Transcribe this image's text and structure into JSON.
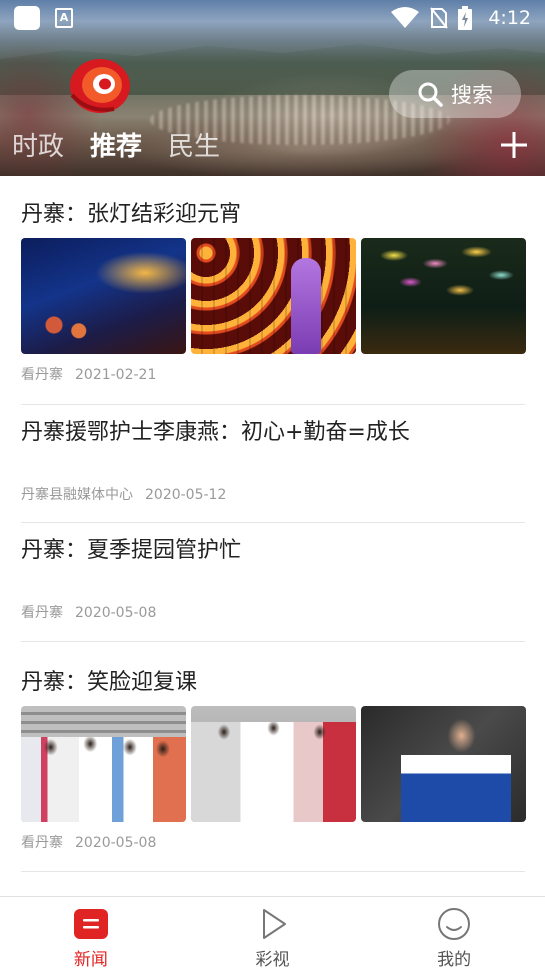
{
  "status_bar": {
    "time": "4:12",
    "icons": [
      "notification-square-icon",
      "app-a-icon",
      "wifi-icon",
      "no-sim-icon",
      "battery-charging-icon"
    ]
  },
  "header": {
    "search_label": "搜索",
    "tabs": [
      {
        "label": "时政",
        "active": false
      },
      {
        "label": "推荐",
        "active": true
      },
      {
        "label": "民生",
        "active": false
      }
    ],
    "add_icon": "plus-icon",
    "accent_color": "#e02424"
  },
  "articles": [
    {
      "title": "丹寨：张灯结彩迎元宵",
      "source": "看丹寨",
      "date": "2021-02-21",
      "has_images": true
    },
    {
      "title": "丹寨援鄂护士李康燕：初心+勤奋=成长",
      "source": "丹寨县融媒体中心",
      "date": "2020-05-12",
      "has_images": false
    },
    {
      "title": "丹寨：夏季提园管护忙",
      "source": "看丹寨",
      "date": "2020-05-08",
      "has_images": false
    },
    {
      "title": "丹寨：笑脸迎复课",
      "source": "看丹寨",
      "date": "2020-05-08",
      "has_images": true
    }
  ],
  "bottom_nav": [
    {
      "label": "新闻",
      "icon": "news-icon",
      "active": true
    },
    {
      "label": "彩视",
      "icon": "play-icon",
      "active": false
    },
    {
      "label": "我的",
      "icon": "smiley-icon",
      "active": false
    }
  ]
}
